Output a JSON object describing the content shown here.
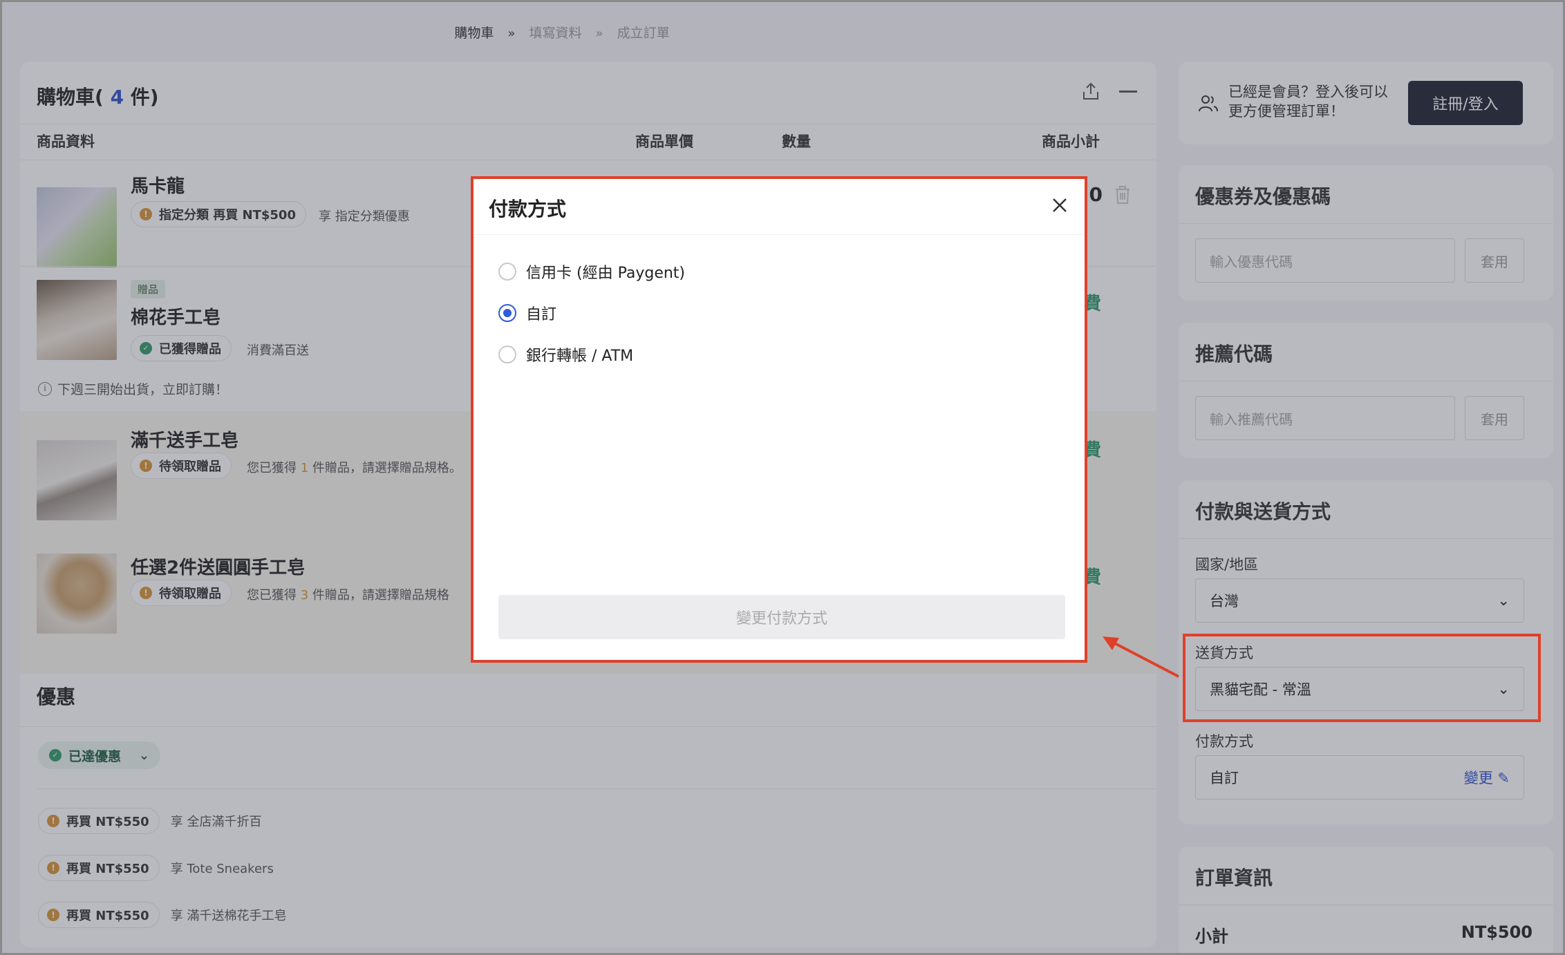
{
  "breadcrumb": {
    "step1": "購物車",
    "step2": "填寫資料",
    "step3": "成立訂單"
  },
  "cart": {
    "title": "購物車",
    "count_open": "( ",
    "count": "4",
    "count_unit": " 件)",
    "columns": {
      "product": "商品資料",
      "price": "商品單價",
      "qty": "數量",
      "subtotal": "商品小計"
    },
    "items": [
      {
        "name": "馬卡龍",
        "pill": "指定分類 再買 NT$500",
        "desc": "享 指定分類優惠",
        "right": "0"
      },
      {
        "tag": "贈品",
        "name": "棉花手工皂",
        "pill": "已獲得贈品",
        "desc": "消費滿百送",
        "note": "下週三開始出貨，立即訂購！",
        "right": "費"
      },
      {
        "name": "滿千送手工皂",
        "pill": "待領取贈品",
        "desc_pre": "您已獲得 ",
        "desc_num": "1",
        "desc_post": " 件贈品，請選擇贈品規格。",
        "right": "費"
      },
      {
        "name": "任選2件送圓圓手工皂",
        "pill": "待領取贈品",
        "desc_pre": "您已獲得 ",
        "desc_num": "3",
        "desc_post": " 件贈品，請選擇贈品規格",
        "right": "費"
      }
    ]
  },
  "promo": {
    "title": "優惠",
    "badge": "已達優惠",
    "rows": [
      {
        "pill": "再買 NT$550",
        "desc": "享 全店滿千折百"
      },
      {
        "pill": "再買 NT$550",
        "desc": "享 Tote Sneakers"
      },
      {
        "pill": "再買 NT$550",
        "desc": "享 滿千送棉花手工皂"
      }
    ]
  },
  "member": {
    "line1": "已經是會員？登入後可以",
    "line2": "更方便管理訂單！",
    "login_button": "註冊/登入"
  },
  "coupon": {
    "title": "優惠券及優惠碼",
    "placeholder": "輸入優惠代碼",
    "apply": "套用"
  },
  "referral": {
    "title": "推薦代碼",
    "placeholder": "輸入推薦代碼",
    "apply": "套用"
  },
  "shipping": {
    "title": "付款與送貨方式",
    "country_label": "國家/地區",
    "country_value": "台灣",
    "delivery_label": "送貨方式",
    "delivery_value": "黑貓宅配 - 常溫",
    "payment_label": "付款方式",
    "payment_value": "自訂",
    "change_link": "變更"
  },
  "order": {
    "title": "訂單資訊",
    "subtotal_label": "小計",
    "subtotal_value": "NT$500"
  },
  "modal": {
    "title": "付款方式",
    "options": [
      {
        "label": "信用卡 (經由 Paygent)",
        "selected": false
      },
      {
        "label": "自訂",
        "selected": true
      },
      {
        "label": "銀行轉帳 / ATM",
        "selected": false
      }
    ],
    "submit": "變更付款方式"
  },
  "colors": {
    "accent_blue": "#2e50c8",
    "highlight_red": "#e0402a",
    "success_green": "#2f9a6a",
    "warn_orange": "#d99435",
    "dark_button": "#1f2230"
  }
}
